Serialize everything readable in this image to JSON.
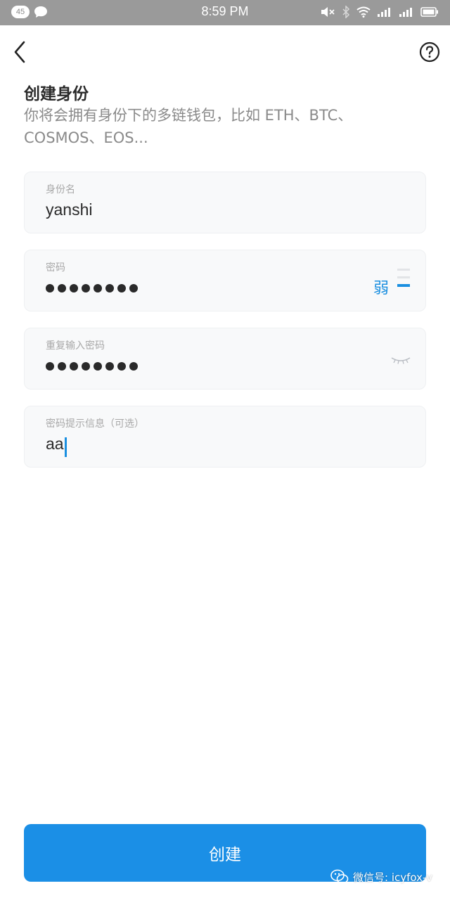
{
  "status_bar": {
    "notification_count": "45",
    "time": "8:59 PM",
    "icons": [
      "chat-icon",
      "mute-icon",
      "bluetooth-icon",
      "wifi-icon",
      "signal-icon",
      "signal-icon-2",
      "battery-icon"
    ]
  },
  "nav": {
    "back_icon": "back-chevron-icon",
    "help_icon": "help-icon"
  },
  "header": {
    "title": "创建身份",
    "subtitle": "你将会拥有身份下的多链钱包，比如 ETH、BTC、COSMOS、EOS..."
  },
  "form": {
    "identity_name": {
      "label": "身份名",
      "value": "yanshi"
    },
    "password": {
      "label": "密码",
      "masked_length": 8,
      "strength_label": "弱",
      "strength_level": 1,
      "strength_max": 3
    },
    "repeat_password": {
      "label": "重复输入密码",
      "masked_length": 8
    },
    "hint": {
      "label": "密码提示信息（可选）",
      "value": "aa"
    }
  },
  "actions": {
    "create_label": "创建"
  },
  "watermark": {
    "text": "微信号: icyfox-v"
  },
  "colors": {
    "accent": "#1b8fe6",
    "status_bar": "#9a9a9a",
    "field_bg": "#f8f9fa"
  }
}
